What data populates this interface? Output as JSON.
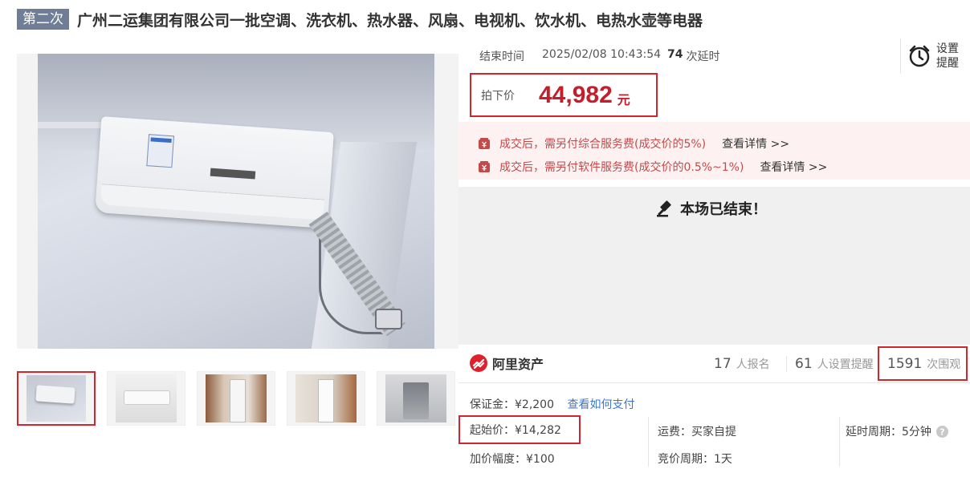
{
  "header": {
    "round_badge": "第二次",
    "title": "广州二运集团有限公司一批空调、洗衣机、热水器、风扇、电视机、饮水机、电热水壶等电器"
  },
  "auction": {
    "end_label": "结束时间",
    "end_time": "2025/02/08 10:43:54",
    "delay_count": "74",
    "delay_text": "次延时",
    "reminder_label": "设置提醒",
    "final_price_label": "拍下价",
    "final_price": "44,982",
    "currency_unit": "元",
    "ended_text": "本场已结束！"
  },
  "fees": [
    {
      "text": "成交后，需另付综合服务费(成交价的5%)",
      "link": "查看详情 >>"
    },
    {
      "text": "成交后，需另付软件服务费(成交价的0.5%~1%)",
      "link": "查看详情 >>"
    }
  ],
  "stats": {
    "brand": "阿里资产",
    "signups": "17",
    "signups_label": "人报名",
    "reminders": "61",
    "reminders_label": "人设置提醒",
    "views": "1591",
    "views_label": "次围观"
  },
  "details": {
    "deposit": "保证金：¥2,200",
    "deposit_link": "查看如何支付",
    "start_price": "起始价：¥14,282",
    "increment": "加价幅度：¥100",
    "shipping": "运费：买家自提",
    "cycle": "竞价周期：1天",
    "delay_period": "延时周期：5分钟"
  },
  "colors": {
    "accent": "#d0262c",
    "price": "#c41e2c",
    "badge": "#6f7e96",
    "link": "#3c78c8"
  },
  "icons": [
    "zoom-icon",
    "alarm-clock-icon",
    "fee-tag-icon",
    "gavel-icon",
    "ali-asset-logo-icon",
    "help-icon"
  ]
}
